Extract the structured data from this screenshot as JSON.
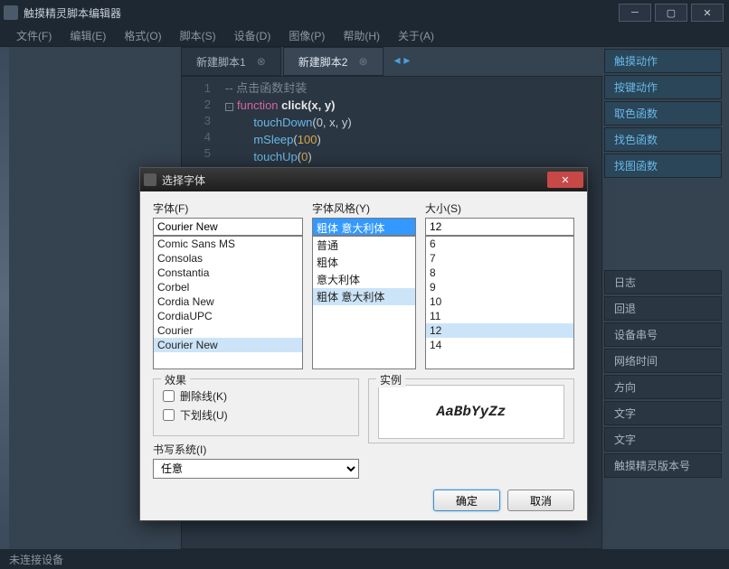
{
  "window": {
    "title": "触摸精灵脚本编辑器"
  },
  "menu": {
    "file": "文件(F)",
    "edit": "编辑(E)",
    "format": "格式(O)",
    "script": "脚本(S)",
    "device": "设备(D)",
    "image": "图像(P)",
    "help": "帮助(H)",
    "about": "关于(A)"
  },
  "tabs": [
    {
      "label": "新建脚本1",
      "active": false
    },
    {
      "label": "新建脚本2",
      "active": true
    }
  ],
  "code": {
    "lines": [
      "1",
      "2",
      "3",
      "4",
      "5"
    ],
    "l1_comment": "-- 点击函数封装",
    "l2_kw": "function",
    "l2_name": " click(x, y)",
    "l3_call": "touchDown",
    "l3_args": "(0, x, y)",
    "l4_call": "mSleep",
    "l4_n": "100",
    "l5_call": "touchUp",
    "l5_n": "0"
  },
  "side_buttons": [
    "触摸动作",
    "按键动作",
    "取色函数",
    "找色函数",
    "找图函数"
  ],
  "side_plain": [
    "日志",
    "回退",
    "设备串号",
    "网络时间",
    "方向",
    "文字",
    "文字",
    "触摸精灵版本号"
  ],
  "statusbar": "未连接设备",
  "dialog": {
    "title": "选择字体",
    "font_label": "字体(F)",
    "font_value": "Courier New",
    "fonts": [
      "Comic Sans MS",
      "Consolas",
      "Constantia",
      "Corbel",
      "Cordia New",
      "CordiaUPC",
      "Courier",
      "Courier New"
    ],
    "style_label": "字体风格(Y)",
    "style_value": "粗体 意大利体",
    "styles": [
      "普通",
      "粗体",
      "意大利体",
      "粗体 意大利体"
    ],
    "size_label": "大小(S)",
    "size_value": "12",
    "sizes": [
      "6",
      "7",
      "8",
      "9",
      "10",
      "11",
      "12",
      "14"
    ],
    "effects_title": "效果",
    "strike_label": "删除线(K)",
    "underline_label": "下划线(U)",
    "writing_label": "书写系统(I)",
    "writing_value": "任意",
    "sample_title": "实例",
    "sample_text": "AaBbYyZz",
    "ok": "确定",
    "cancel": "取消"
  }
}
